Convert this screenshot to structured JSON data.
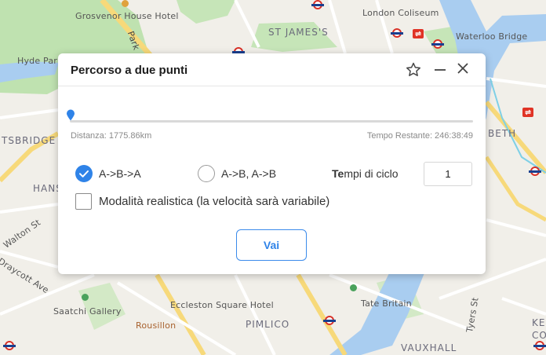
{
  "map": {
    "labels": {
      "grosvenor_house": "Grosvenor House Hotel",
      "london_coliseum": "London Coliseum",
      "st_james": "ST JAMES'S",
      "waterloo_bridge": "Waterloo Bridge",
      "hyde_park": "Hyde Park",
      "park_lane": "Park",
      "knightsbridge": "TSBRIDGE",
      "beth": "BETH",
      "hans": "HANS",
      "walton_st": "Walton St",
      "draycott_ave": "Draycott Ave",
      "saatchi": "Saatchi Gallery",
      "eccleston": "Eccleston Square Hotel",
      "tate": "Tate Britain",
      "rousillon": "Rousillon",
      "pimlico": "PIMLICO",
      "tyers_st": "Tyers St",
      "vauxhall": "VAUXHALL",
      "kenning": "KENNIN",
      "co": "CO"
    }
  },
  "dialog": {
    "title": "Percorso a due punti",
    "distance": "Distanza: 1775.86km",
    "remaining": "Tempo Restante: 246:38:49",
    "progress": 0,
    "option_aba": "A->B->A",
    "option_abab": "A->B, A->B",
    "selected_option": "A->B->A",
    "cycles_label_bold": "Te",
    "cycles_label_rest": "mpi di ciclo",
    "cycles_value": "1",
    "realistic_label": "Modalità realistica (la velocità sarà variabile)",
    "realistic_checked": false,
    "go_label": "Vai",
    "accent_color": "#2f83e8"
  }
}
